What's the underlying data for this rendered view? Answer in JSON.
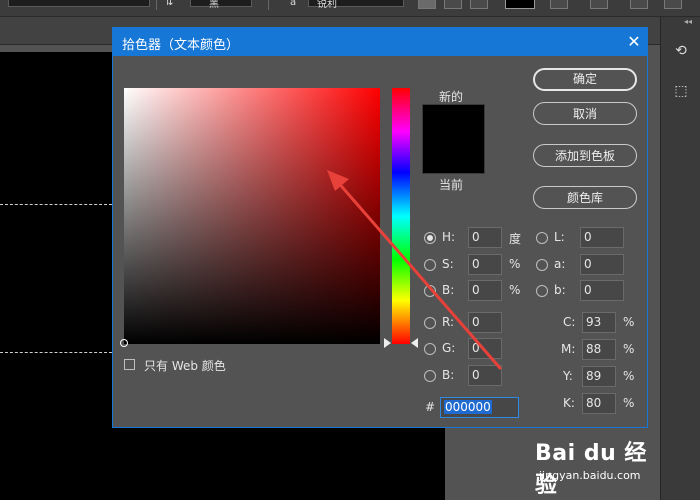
{
  "toolbar": {
    "font_style": "黑",
    "font_size_prefix": "a",
    "anti_alias": "锐利"
  },
  "dialog": {
    "title": "拾色器（文本颜色）",
    "close_glyph": "✕",
    "new_label": "新的",
    "current_label": "当前",
    "buttons": {
      "ok": "确定",
      "cancel": "取消",
      "add_to_swatches": "添加到色板",
      "color_libraries": "颜色库"
    },
    "web_only_label": "只有 Web 颜色",
    "hsb": [
      {
        "label": "H:",
        "value": "0",
        "unit": "度",
        "selected": true
      },
      {
        "label": "S:",
        "value": "0",
        "unit": "%",
        "selected": false
      },
      {
        "label": "B:",
        "value": "0",
        "unit": "%",
        "selected": false
      }
    ],
    "rgb": [
      {
        "label": "R:",
        "value": "0"
      },
      {
        "label": "G:",
        "value": "0"
      },
      {
        "label": "B:",
        "value": "0"
      }
    ],
    "lab": [
      {
        "label": "L:",
        "value": "0"
      },
      {
        "label": "a:",
        "value": "0"
      },
      {
        "label": "b:",
        "value": "0"
      }
    ],
    "cmyk": [
      {
        "label": "C:",
        "value": "93",
        "unit": "%"
      },
      {
        "label": "M:",
        "value": "88",
        "unit": "%"
      },
      {
        "label": "Y:",
        "value": "89",
        "unit": "%"
      },
      {
        "label": "K:",
        "value": "80",
        "unit": "%"
      }
    ],
    "hex_prefix": "#",
    "hex_value": "000000"
  },
  "watermark": {
    "logo_text": "Bai du 经验",
    "url": "jingyan.baidu.com"
  },
  "colors": {
    "accent": "#1677d6",
    "arrow": "#e8413a",
    "current_color": "#000000"
  }
}
